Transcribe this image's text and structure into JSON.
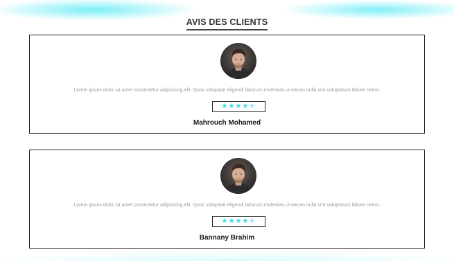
{
  "section": {
    "title": "AVIS DES CLIENTS"
  },
  "colors": {
    "accent": "#3cd9ea",
    "border": "#222222",
    "text_muted": "#9a9a9a"
  },
  "reviews": [
    {
      "avatar_icon": "user-portrait",
      "text": "Lorem ipsum dolor sit amet consectetur adipisicing elit. Quos voluptate eligendi laborum molestias ut earum nulla sint voluptatum labore nemo.",
      "rating": 4.5,
      "rating_max": 5,
      "name": "Mahrouch Mohamed"
    },
    {
      "avatar_icon": "user-portrait",
      "text": "Lorem ipsum dolor sit amet consectetur adipisicing elit. Quos voluptate eligendi laborum molestias ut earum nulla sint voluptatum labore nemo.",
      "rating": 4.5,
      "rating_max": 5,
      "name": "Bannany Brahim"
    }
  ]
}
